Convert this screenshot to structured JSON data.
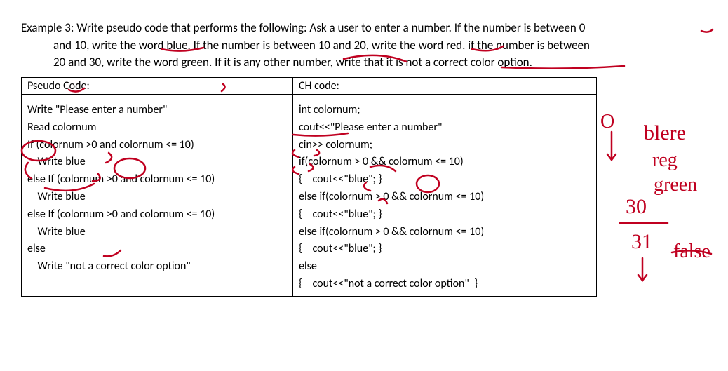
{
  "prompt": {
    "line1": "Example 3: Write pseudo code that performs the following: Ask a user to enter a number. If the number is between 0",
    "line2": "and 10, write the word blue. If the number is between 10 and 20, write the word red. if the number is between",
    "line3": "20 and 30, write the word green. If it is any other number, write that it is not a correct color option."
  },
  "table": {
    "header_left": "Pseudo Code:",
    "header_right": "CH code:",
    "pseudo": "Write \"Please enter a number\"\nRead colornum\nIf (colornum >0 and colornum <= 10)\n    Write blue\nelse If (colornum >0 and colornum <= 10)\n    Write blue\nelse If (colornum >0 and colornum <= 10)\n    Write blue\nelse\n    Write \"not a correct color option\"",
    "ccode": "int colornum;\ncout<<\"Please enter a number\"\ncin>> colornum;\nif(colornum > 0 && colornum <= 10)\n{    cout<<\"blue\"; }\nelse if(colornum > 0 && colornum <= 10)\n{    cout<<\"blue\"; }\nelse if(colornum > 0 && colornum <= 10)\n{    cout<<\"blue\"; }\nelse\n{    cout<<\"not a correct color option\"  }"
  },
  "annotations": {
    "right_top_word": "blere",
    "right_word2": "reg",
    "right_word3": "green",
    "thirty": "30",
    "thirtyone": "31",
    "false": "false",
    "zero_circle": "O"
  }
}
